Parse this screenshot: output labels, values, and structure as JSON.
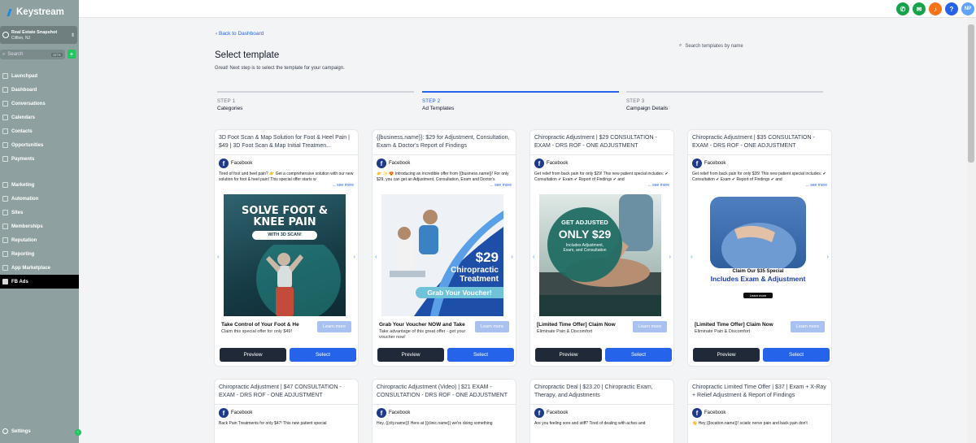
{
  "app": {
    "brand": "Keystream",
    "account_name": "Real Estate Snapshot",
    "account_location": "Clifton, NJ",
    "search_placeholder": "Search",
    "search_shortcut": "ctrl K",
    "add_label": "+",
    "settings_label": "Settings",
    "collapse_glyph": "‹",
    "user_initials": "NP"
  },
  "nav": {
    "group1": [
      {
        "label": "Launchpad"
      },
      {
        "label": "Dashboard"
      },
      {
        "label": "Conversations"
      },
      {
        "label": "Calendars"
      },
      {
        "label": "Contacts"
      },
      {
        "label": "Opportunities"
      },
      {
        "label": "Payments"
      }
    ],
    "group2": [
      {
        "label": "Marketing"
      },
      {
        "label": "Automation"
      },
      {
        "label": "Sites"
      },
      {
        "label": "Memberships"
      },
      {
        "label": "Reputation"
      },
      {
        "label": "Reporting"
      },
      {
        "label": "App Marketplace"
      },
      {
        "label": "FB Ads",
        "active": true
      }
    ]
  },
  "page": {
    "back": "Back to Dashboard",
    "title": "Select template",
    "subtitle": "Great! Next step is to select the template for your campaign.",
    "search_placeholder": "Search templates by name"
  },
  "steps": [
    {
      "num": "STEP 1",
      "label": "Categories",
      "active": false
    },
    {
      "num": "STEP 2",
      "label": "Ad Templates",
      "active": true
    },
    {
      "num": "STEP 3",
      "label": "Campaign Details",
      "active": false
    }
  ],
  "common": {
    "platform": "Facebook",
    "see_more": "... see more",
    "preview": "Preview",
    "select": "Select",
    "learn_more": "Learn more",
    "fb_glyph": "f",
    "arrow_left": "‹",
    "arrow_right": "›"
  },
  "cards": [
    {
      "title": "3D Foot Scan & Map Solution for Foot & Heel Pain | $49 | 3D Foot Scan & Map Initial Treatmen...",
      "text": "Tired of foot and heel pain? 👉 Get a comprehensive solution with our new solution for foot & heel pain! This special offer starts w",
      "cta_title": "Take Control of Your Foot & He",
      "cta_desc": "Claim this special offer for only $49!",
      "img": {
        "line1": "SOLVE FOOT &",
        "line2": "KNEE PAIN",
        "badge": "WITH 3D SCAN!"
      }
    },
    {
      "title": "{{business.name}}: $29 for Adjustment, Consultation, Exam & Doctor's Report of Findings",
      "text": "👉 ✨ 😍 Introducing an incredible offer from {{business.name}}! For only $29, you can get an Adjustment, Consultation, Exam and Doctor's",
      "cta_title": "Grab Your Voucher NOW and Take",
      "cta_desc": "Take advantage of this great offer - get your voucher now!",
      "img": {
        "price": "$29",
        "line1": "Chiropractic",
        "line2": "Treatment",
        "banner": "Grab Your Voucher!"
      }
    },
    {
      "title": "Chiropractic Adjustment | $29 CONSULTATION - EXAM - DRS ROF - ONE ADJUSTMENT",
      "text": "Get relief from back pain for only $29! This new patient special includes: ✔ Consultation ✔ Exam ✔ Report of Findings ✔ and",
      "cta_title": "[Limited Time Offer] Claim Now",
      "cta_desc": "Eliminate Pain & Discomfort",
      "img": {
        "line1": "GET ADJUSTED",
        "line2": "ONLY $29",
        "small": "Includes Adjustment, Exam, and Consultation"
      }
    },
    {
      "title": "Chiropractic Adjustment | $35 CONSULTATION - EXAM - DRS ROF - ONE ADJUSTMENT",
      "text": "Get relief from back pain for only $35! This new patient special includes: ✔ Consultation ✔ Exam ✔ Report of Findings ✔ and",
      "cta_title": "[Limited Time Offer] Claim Now",
      "cta_desc": "Eliminate Pain & Discomfort",
      "img": {
        "line1": "Claim Our $35 Special",
        "line2": "Includes Exam & Adjustment",
        "btn": "Learn more"
      }
    },
    {
      "title": "Chiropractic Adjustment | $47 CONSULTATION - EXAM - DRS ROF - ONE ADJUSTMENT",
      "text": "Back Pain Treatments for only $47! This new patient special"
    },
    {
      "title": "Chiropractic Adjustment (Video) | $21 EXAM - CONSULTATION - DRS ROF - ONE ADJUSTMENT",
      "text": "Hey, {{city.name}}! Here at {{clinic.name}} we're doing something"
    },
    {
      "title": "Chiropractic Deal | $23.20 | Chiropractic Exam, Therapy, and Adjustments",
      "text": "Are you feeling sore and stiff? Tired of dealing with aches and"
    },
    {
      "title": "Chiropractic Limited Time Offer | $37 | Exam + X-Ray + Relief Adjustment & Report of Findings",
      "text": "👋 Hey {{location.name}}! sciatic nerve pain and back pain don't"
    }
  ]
}
